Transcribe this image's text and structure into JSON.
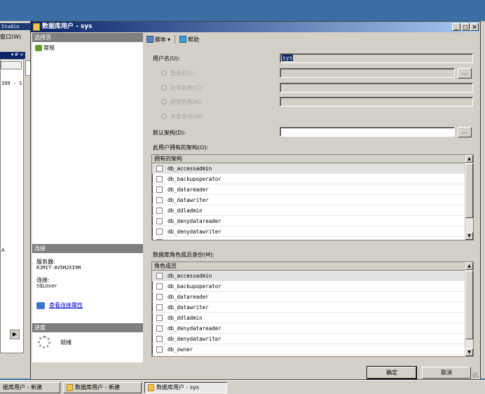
{
  "background_app": {
    "title_fragment": "Studio",
    "menu_fragment": "窗口(W)",
    "pane_controls": "▾ ₽ ×",
    "server_fragment": "399 - S",
    "letter": "A",
    "scroll_arrow": "▶"
  },
  "window": {
    "title": "数据库用户 - sys",
    "buttons": [
      "_",
      "□",
      "×"
    ]
  },
  "left_panel": {
    "pages_header": "选择页",
    "pages": [
      {
        "label": "常规"
      }
    ],
    "connection_header": "连接",
    "server_label": "服务器:",
    "server_value": "RJMIT-8V5M2XI9M",
    "connection_label": "连接:",
    "connection_value": "SQLUser",
    "view_connection_link": "查看连接属性",
    "progress_header": "进度",
    "progress_status": "就绪"
  },
  "toolbar": {
    "script_label": "脚本",
    "script_dropdown": "▾",
    "help_label": "帮助"
  },
  "form": {
    "username_label": "用户名(U):",
    "username_value": "sys",
    "login_name_label": "登录名(L):",
    "cert_name_label": "证书名称(C):",
    "key_name_label": "密钥名称(K):",
    "no_login_label": "无登录名(W)",
    "default_schema_label": "默认架构(D):",
    "default_schema_value": "",
    "browse_label": "...",
    "owned_schemas_label": "此用户拥有的架构(O):",
    "role_members_label": "数据库角色成员身份(M):"
  },
  "owned_schemas": {
    "header": "拥有的架构",
    "rows": [
      {
        "name": "db_accessadmin"
      },
      {
        "name": "db_backupoperator"
      },
      {
        "name": "db_datareader"
      },
      {
        "name": "db_datawriter"
      },
      {
        "name": "db_ddladmin"
      },
      {
        "name": "db_denydatareader"
      },
      {
        "name": "db_denydatawriter"
      },
      {
        "name": "db_owner"
      }
    ]
  },
  "role_membership": {
    "header": "角色成员",
    "rows": [
      {
        "name": "db_accessadmin"
      },
      {
        "name": "db_backupoperator"
      },
      {
        "name": "db_datareader"
      },
      {
        "name": "db_datawriter"
      },
      {
        "name": "db_ddladmin"
      },
      {
        "name": "db_denydatareader"
      },
      {
        "name": "db_denydatawriter"
      },
      {
        "name": "db_owner"
      }
    ]
  },
  "buttons": {
    "ok": "确定",
    "cancel": "取消"
  },
  "taskbar": {
    "items": [
      {
        "label": "据库用户 - 新建"
      },
      {
        "label": "数据库用户 - 新建"
      },
      {
        "label": "数据库用户 - sys"
      }
    ]
  },
  "colors": {
    "title_active": "#0a246a",
    "selection": "#0a246a",
    "link": "#0000cc",
    "face": "#d4d0c8"
  }
}
